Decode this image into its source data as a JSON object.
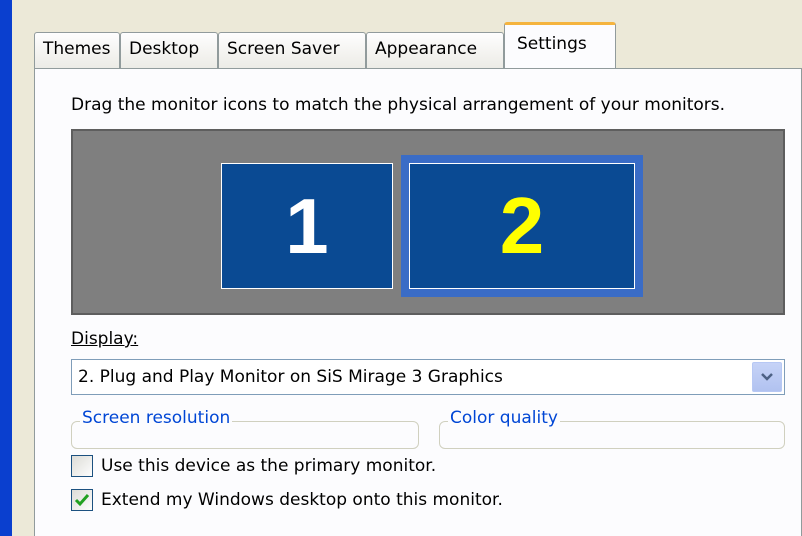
{
  "tabs": [
    {
      "label": "Themes"
    },
    {
      "label": "Desktop"
    },
    {
      "label": "Screen Saver"
    },
    {
      "label": "Appearance"
    },
    {
      "label": "Settings",
      "active": true
    }
  ],
  "instruction": "Drag the monitor icons to match the physical arrangement of your monitors.",
  "monitors": [
    {
      "number": "1",
      "selected": false
    },
    {
      "number": "2",
      "selected": true
    }
  ],
  "display": {
    "label": "Display:",
    "selected": "2. Plug and Play Monitor on SiS Mirage 3 Graphics"
  },
  "groups": {
    "screen_resolution": "Screen resolution",
    "color_quality": "Color quality"
  },
  "checkboxes": [
    {
      "label": "Use this device as the primary monitor.",
      "checked": false
    },
    {
      "label": "Extend my Windows desktop onto this monitor.",
      "checked": true
    }
  ],
  "colors": {
    "monitor_bg": "#0a4a93",
    "selected_monitor_number": "#ffff00",
    "tab_highlight": "#f5b43e",
    "group_label": "#0046d5"
  }
}
